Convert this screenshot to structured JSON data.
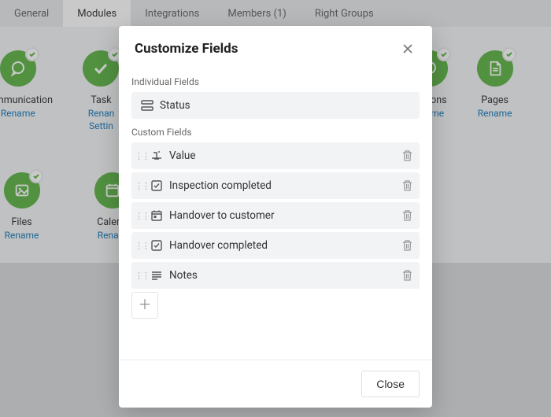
{
  "tabs": {
    "items": [
      {
        "label": "General",
        "active": false
      },
      {
        "label": "Modules",
        "active": true
      },
      {
        "label": "Integrations",
        "active": false
      },
      {
        "label": "Members (1)",
        "active": false
      },
      {
        "label": "Right Groups",
        "active": false
      }
    ]
  },
  "modules": {
    "row1": [
      {
        "title": "Communication",
        "links": [
          "Rename"
        ]
      },
      {
        "title": "Task",
        "links": [
          "Renan",
          "Settin"
        ]
      },
      {
        "title": "ussions",
        "links": [
          "ename"
        ]
      },
      {
        "title": "Pages",
        "links": [
          "Rename"
        ]
      }
    ],
    "row2": [
      {
        "title": "Files",
        "links": [
          "Rename"
        ]
      },
      {
        "title": "Calend",
        "links": [
          "Renam"
        ]
      }
    ]
  },
  "modal": {
    "title": "Customize Fields",
    "section_individual": "Individual Fields",
    "section_custom": "Custom Fields",
    "individual_fields": [
      {
        "name": "Status",
        "type": "status"
      }
    ],
    "custom_fields": [
      {
        "name": "Value",
        "type": "number"
      },
      {
        "name": "Inspection completed",
        "type": "checkbox"
      },
      {
        "name": "Handover to customer",
        "type": "date"
      },
      {
        "name": "Handover completed",
        "type": "checkbox"
      },
      {
        "name": "Notes",
        "type": "text"
      }
    ],
    "close_label": "Close"
  }
}
